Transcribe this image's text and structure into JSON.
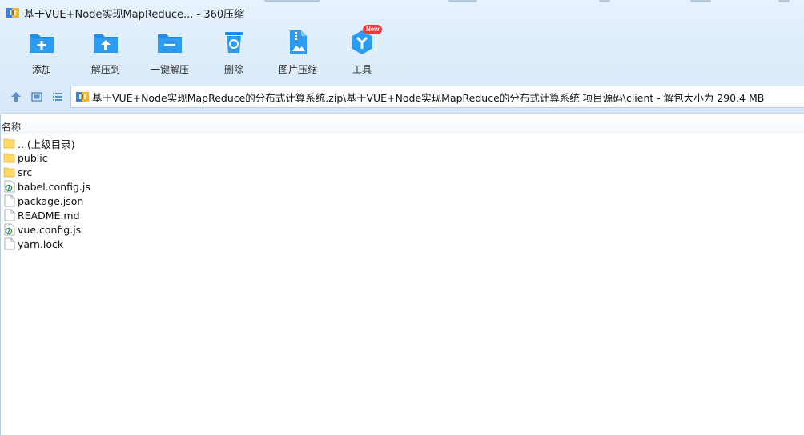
{
  "window": {
    "title": "基于VUE+Node实现MapReduce... - 360压缩"
  },
  "toolbar": {
    "items": [
      {
        "label": "添加",
        "icon": "folder-add-icon"
      },
      {
        "label": "解压到",
        "icon": "folder-extract-icon"
      },
      {
        "label": "一键解压",
        "icon": "folder-oneclick-icon"
      },
      {
        "label": "删除",
        "icon": "trash-icon"
      },
      {
        "label": "图片压缩",
        "icon": "image-compress-icon"
      },
      {
        "label": "工具",
        "icon": "tools-icon",
        "badge": "New"
      }
    ]
  },
  "address": {
    "path": "基于VUE+Node实现MapReduce的分布式计算系统.zip\\基于VUE+Node实现MapReduce的分布式计算系统 项目源码\\client - 解包大小为 290.4 MB"
  },
  "list": {
    "column_name": "名称",
    "rows": [
      {
        "name": ".. (上级目录)",
        "type": "folder"
      },
      {
        "name": "public",
        "type": "folder"
      },
      {
        "name": "src",
        "type": "folder"
      },
      {
        "name": "babel.config.js",
        "type": "js"
      },
      {
        "name": "package.json",
        "type": "file"
      },
      {
        "name": "README.md",
        "type": "file"
      },
      {
        "name": "vue.config.js",
        "type": "js"
      },
      {
        "name": "yarn.lock",
        "type": "file"
      }
    ]
  },
  "colors": {
    "accent": "#1e8ee8",
    "badge": "#ea3b3b",
    "folder": "#ffd866"
  }
}
